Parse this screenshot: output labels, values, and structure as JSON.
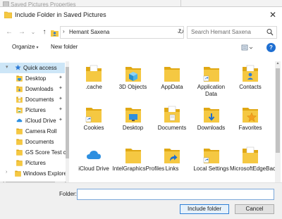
{
  "background_window": {
    "title": "Saved Pictures Properties"
  },
  "dialog": {
    "title": "Include Folder in Saved Pictures",
    "close_glyph": "✕"
  },
  "nav": {
    "back_glyph": "←",
    "forward_glyph": "→",
    "recent_glyph": "⌄",
    "up_glyph": "↑",
    "breadcrumb_sep": "›",
    "address": "Hemant Saxena",
    "address_dropdown_glyph": "⌄",
    "refresh_glyph": "↻",
    "search_placeholder": "Search Hemant Saxena",
    "search_glyph": "⚲"
  },
  "toolbar": {
    "organize_label": "Organize",
    "organize_caret": "▾",
    "new_folder_label": "New folder",
    "help_label": "?"
  },
  "sidebar": {
    "items": [
      {
        "label": "Quick access",
        "icon": "star-icon",
        "pinned": false,
        "selected": true,
        "expander": "▾"
      },
      {
        "label": "Desktop",
        "icon": "desktop-folder-icon",
        "pinned": true
      },
      {
        "label": "Downloads",
        "icon": "downloads-icon",
        "pinned": true
      },
      {
        "label": "Documents",
        "icon": "documents-icon",
        "pinned": true
      },
      {
        "label": "Pictures",
        "icon": "pictures-icon",
        "pinned": true
      },
      {
        "label": "iCloud Drive",
        "icon": "icloud-icon",
        "pinned": true
      },
      {
        "label": "Camera Roll",
        "icon": "folder-icon",
        "pinned": false
      },
      {
        "label": "Documents",
        "icon": "folder-icon",
        "pinned": false
      },
      {
        "label": "GS Score Test co",
        "icon": "folder-icon",
        "pinned": false
      },
      {
        "label": "Pictures",
        "icon": "folder-icon",
        "pinned": false
      },
      {
        "label": "Windows Explorer",
        "icon": "folder-icon",
        "pinned": false,
        "expander": "›"
      }
    ],
    "pin_glyph": "✦"
  },
  "files": [
    {
      "label": ".cache",
      "icon": "folder-doc-icon"
    },
    {
      "label": "3D Objects",
      "icon": "3d-objects-icon"
    },
    {
      "label": "AppData",
      "icon": "folder-icon"
    },
    {
      "label": "Application Data",
      "icon": "folder-shortcut-icon"
    },
    {
      "label": "Contacts",
      "icon": "contacts-icon"
    },
    {
      "label": "Cookies",
      "icon": "folder-shortcut-icon"
    },
    {
      "label": "Desktop",
      "icon": "desktop-folder-icon"
    },
    {
      "label": "Documents",
      "icon": "documents-icon"
    },
    {
      "label": "Downloads",
      "icon": "downloads-icon"
    },
    {
      "label": "Favorites",
      "icon": "favorites-icon"
    },
    {
      "label": "iCloud Drive",
      "icon": "icloud-icon"
    },
    {
      "label": "IntelGraphicsProfiles",
      "icon": "folder-icon"
    },
    {
      "label": "Links",
      "icon": "links-icon"
    },
    {
      "label": "Local Settings",
      "icon": "folder-shortcut-icon"
    },
    {
      "label": "MicrosoftEdgeBackups",
      "icon": "folder-doc-icon"
    }
  ],
  "footer": {
    "folder_label": "Folder:",
    "folder_value": "",
    "include_button": "Include folder",
    "cancel_button": "Cancel"
  },
  "colors": {
    "folder": "#f5c842",
    "folder_dark": "#e0a814",
    "accent": "#1f6fd1",
    "selected_bg": "#cde6f7"
  }
}
